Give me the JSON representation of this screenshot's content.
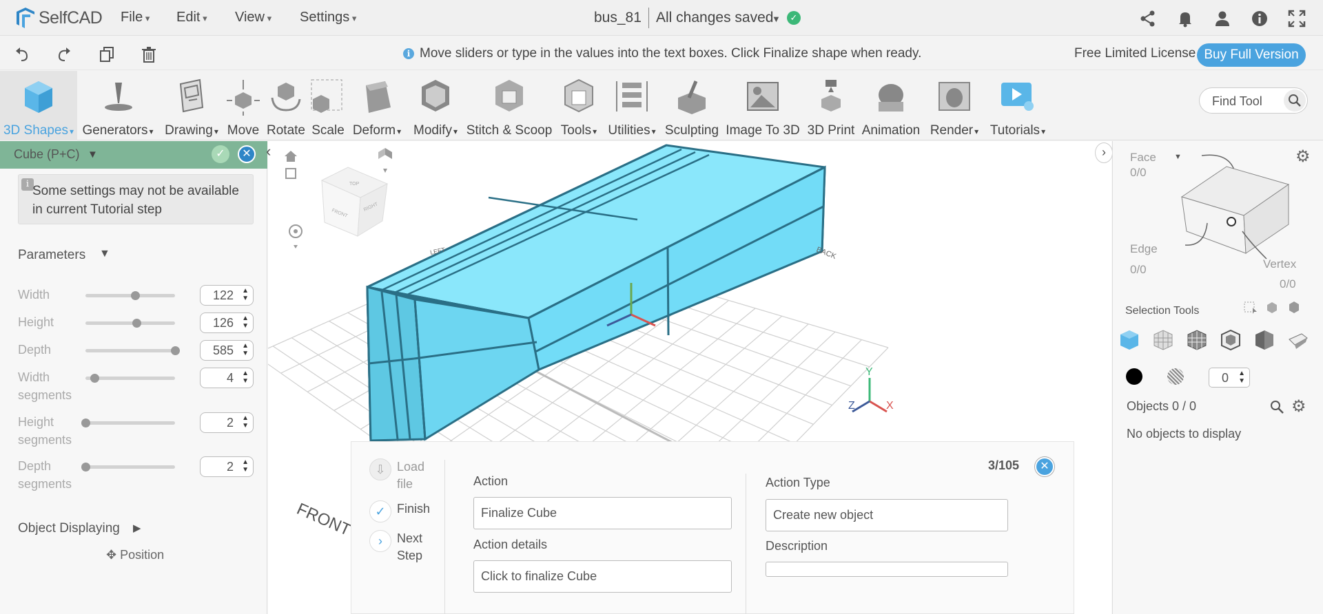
{
  "app": {
    "name": "SelfCAD",
    "menus": [
      "File",
      "Edit",
      "View",
      "Settings"
    ],
    "document_title": "bus_81",
    "save_status": "All changes saved"
  },
  "hintbar": {
    "hint": "Move sliders or type in the values into the text boxes. Click Finalize shape when ready.",
    "license": "Free Limited License",
    "buy_button": "Buy Full Version"
  },
  "toolbar": {
    "tools": [
      {
        "label": "3D Shapes",
        "dropdown": true,
        "active": true,
        "icon": "cube-icon"
      },
      {
        "label": "Generators",
        "dropdown": true,
        "icon": "generators-icon"
      },
      {
        "label": "Drawing",
        "dropdown": true,
        "icon": "drawing-icon"
      },
      {
        "label": "Move",
        "dropdown": false,
        "icon": "move-icon"
      },
      {
        "label": "Rotate",
        "dropdown": false,
        "icon": "rotate-icon"
      },
      {
        "label": "Scale",
        "dropdown": false,
        "icon": "scale-icon"
      },
      {
        "label": "Deform",
        "dropdown": true,
        "icon": "deform-icon"
      },
      {
        "label": "Modify",
        "dropdown": true,
        "icon": "modify-icon"
      },
      {
        "label": "Stitch & Scoop",
        "dropdown": false,
        "icon": "stitch-scoop-icon"
      },
      {
        "label": "Tools",
        "dropdown": true,
        "icon": "tools-icon"
      },
      {
        "label": "Utilities",
        "dropdown": true,
        "icon": "utilities-icon"
      },
      {
        "label": "Sculpting",
        "dropdown": false,
        "icon": "sculpting-icon"
      },
      {
        "label": "Image To 3D",
        "dropdown": false,
        "icon": "image-to-3d-icon"
      },
      {
        "label": "3D Print",
        "dropdown": false,
        "icon": "3d-print-icon"
      },
      {
        "label": "Animation",
        "dropdown": false,
        "icon": "animation-icon"
      },
      {
        "label": "Render",
        "dropdown": true,
        "icon": "render-icon"
      },
      {
        "label": "Tutorials",
        "dropdown": true,
        "icon": "tutorials-icon"
      }
    ],
    "find_tool_placeholder": "Find Tool"
  },
  "left_panel": {
    "title": "Cube (P+C)",
    "tutorial_note": "Some settings may not be available in current Tutorial step",
    "parameters_title": "Parameters",
    "parameters": [
      {
        "label": "Width",
        "value": "122",
        "slider_fraction": 0.55
      },
      {
        "label": "Height",
        "value": "126",
        "slider_fraction": 0.57
      },
      {
        "label": "Depth",
        "value": "585",
        "slider_fraction": 1.0
      },
      {
        "label": "Width segments",
        "value": "4",
        "slider_fraction": 0.1
      },
      {
        "label": "Height segments",
        "value": "2",
        "slider_fraction": 0.0
      },
      {
        "label": "Depth segments",
        "value": "2",
        "slider_fraction": 0.0
      }
    ],
    "object_displaying": "Object Displaying",
    "position": "Position"
  },
  "viewport": {
    "view_cube_faces": [
      "TOP",
      "FRONT",
      "RIGHT"
    ],
    "ground_labels": [
      "FRONT",
      "LEFT",
      "BACK"
    ],
    "axes": [
      "Y",
      "Z",
      "X"
    ],
    "object_color": "#72dcf7"
  },
  "tutorial": {
    "steps": [
      {
        "label": "Load file",
        "state": "done"
      },
      {
        "label": "Finish",
        "state": "current"
      },
      {
        "label": "Next Step",
        "state": "next"
      }
    ],
    "action_label": "Action",
    "action_value": "Finalize Cube",
    "action_details_label": "Action details",
    "action_details_value": "Click to finalize Cube",
    "action_type_label": "Action Type",
    "action_type_value": "Create new object",
    "description_label": "Description",
    "description_value": "",
    "counter": "3/105"
  },
  "right_panel": {
    "face_label": "Face",
    "face_count": "0/0",
    "edge_label": "Edge",
    "edge_count": "0/0",
    "vertex_label": "Vertex",
    "vertex_count": "0/0",
    "selection_tools": "Selection Tools",
    "selection_value": "0",
    "objects_label": "Objects 0 / 0",
    "no_objects": "No objects to display"
  },
  "colors": {
    "accent": "#4aa3df",
    "panel_header": "#7fb597",
    "saved_green": "#3cb878"
  }
}
